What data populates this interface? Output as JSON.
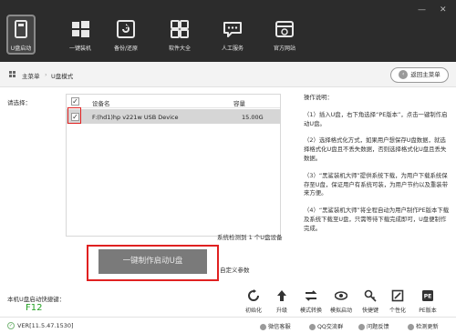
{
  "nav": {
    "items": [
      {
        "label": "U盘启动",
        "icon": "usb-drive-icon"
      },
      {
        "label": "一键装机",
        "icon": "windows-icon"
      },
      {
        "label": "备份/还原",
        "icon": "backup-restore-icon"
      },
      {
        "label": "软件大全",
        "icon": "software-grid-icon"
      },
      {
        "label": "人工服务",
        "icon": "chat-icon"
      },
      {
        "label": "官方网站",
        "icon": "website-icon"
      }
    ],
    "window_controls": [
      "—",
      "✕"
    ]
  },
  "breadcrumb": {
    "items": [
      "主菜单",
      "U盘模式"
    ],
    "back_button": "返回主菜单"
  },
  "device_selection": {
    "label": "请选择：",
    "columns": [
      "设备名",
      "容量"
    ],
    "rows": [
      {
        "checked": true,
        "name": "F:(hd1)hp v221w USB Device",
        "capacity": "15.00G"
      }
    ],
    "detect_text": "系统检测到 1 个U盘设备"
  },
  "create_button": "一键制作启动U盘",
  "custom_params": "自定义参数",
  "instructions": {
    "title": "操作说明：",
    "steps": [
      "（1）插入U盘，右下角选择“PE版本”，点击一键制作启动U盘。",
      "（2）选择格式化方式，如果用户想保存U盘数据，就选择格式化U盘且不丢失数据，否则选择格式化U盘且丢失数据。",
      "（3）“黑鲨装机大师”提供系统下载，为用户下载系统保存至U盘，保证用户有系统可装，为用户节约以及重装带来方便。",
      "（4）“黑鲨装机大师”将全程自动为用户制作PE版本下载及系统下载至U盘，只需等待下载完成即可，U盘便制作完成。"
    ]
  },
  "hotkey": {
    "label": "本机U盘启动快捷键：",
    "value": "F12"
  },
  "version": "VER[11.5.47.1530]",
  "tools": [
    {
      "label": "初始化",
      "icon": "reset-icon"
    },
    {
      "label": "升级",
      "icon": "upgrade-icon"
    },
    {
      "label": "模式转换",
      "icon": "convert-icon"
    },
    {
      "label": "模拟启动",
      "icon": "simulate-icon"
    },
    {
      "label": "快捷键",
      "icon": "shortcut-key-icon"
    },
    {
      "label": "个性化",
      "icon": "personalize-icon"
    },
    {
      "label": "PE版本",
      "icon": "pe-version-icon"
    }
  ],
  "footer_links": [
    "微信客服",
    "QQ交流群",
    "问题反馈",
    "检测更新"
  ]
}
